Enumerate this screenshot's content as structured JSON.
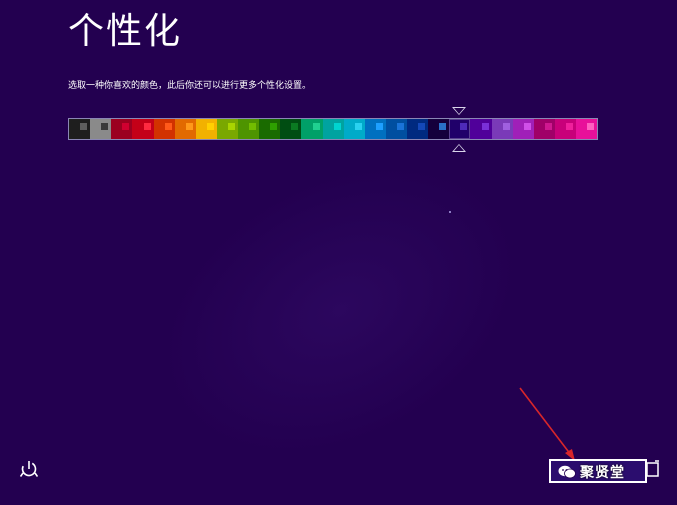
{
  "page": {
    "title": "个性化",
    "subtitle": "选取一种你喜欢的颜色，此后你还可以进行更多个性化设置。"
  },
  "palette": {
    "selected_index": 18,
    "swatches": [
      {
        "bg": "#1e1e1e",
        "fg": "#5e5e5e"
      },
      {
        "bg": "#8a8a8a",
        "fg": "#3a3a3a"
      },
      {
        "bg": "#9b0020",
        "fg": "#d00030"
      },
      {
        "bg": "#c40018",
        "fg": "#ff2a40"
      },
      {
        "bg": "#d23200",
        "fg": "#ff5a1a"
      },
      {
        "bg": "#e26a00",
        "fg": "#ff9a1a"
      },
      {
        "bg": "#f2b100",
        "fg": "#ffd000"
      },
      {
        "bg": "#7aa800",
        "fg": "#a8d400"
      },
      {
        "bg": "#4e9400",
        "fg": "#72bd00"
      },
      {
        "bg": "#1a6b00",
        "fg": "#2ea000"
      },
      {
        "bg": "#004d12",
        "fg": "#0b7a22"
      },
      {
        "bg": "#00a068",
        "fg": "#20d090"
      },
      {
        "bg": "#00a3a0",
        "fg": "#00d4d0"
      },
      {
        "bg": "#00abc9",
        "fg": "#2ad2f0"
      },
      {
        "bg": "#0070c0",
        "fg": "#1ea0ff"
      },
      {
        "bg": "#004fa0",
        "fg": "#1a74d8"
      },
      {
        "bg": "#002a80",
        "fg": "#1448b8"
      },
      {
        "bg": "#14003c",
        "fg": "#2a70c8"
      },
      {
        "bg": "#20006a",
        "fg": "#4d2ab8"
      },
      {
        "bg": "#50009a",
        "fg": "#7a30d8"
      },
      {
        "bg": "#7a3ab8",
        "fg": "#a060e0"
      },
      {
        "bg": "#a020b8",
        "fg": "#d050e8"
      },
      {
        "bg": "#a00068",
        "fg": "#d01890"
      },
      {
        "bg": "#c8007a",
        "fg": "#f0209c"
      },
      {
        "bg": "#e8109a",
        "fg": "#ff60c0"
      }
    ]
  },
  "footer": {
    "ease_of_access_icon": "ease-of-access-icon",
    "watermark_text": "聚贤堂"
  },
  "colors": {
    "background": "#230050",
    "accent_arrow": "#d8262a"
  }
}
